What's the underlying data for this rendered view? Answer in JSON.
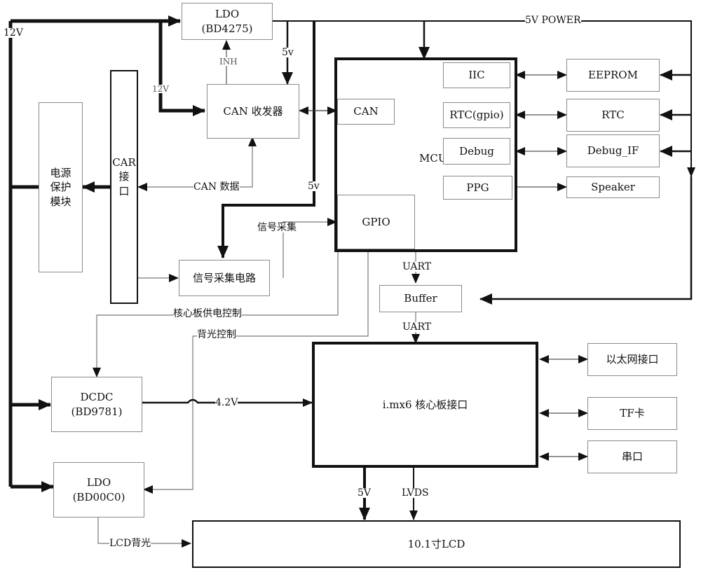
{
  "blocks": {
    "ldo_top": {
      "line1": "LDO",
      "line2": "(BD4275)"
    },
    "can_transceiver": "CAN 收发器",
    "power_protect": "电源\n保护\n模块",
    "car_interface": "CAR\n接\n口",
    "signal_circuit": "信号采集电路",
    "mcu": "MCU",
    "mcu_can": "CAN",
    "mcu_gpio": "GPIO",
    "mcu_iic": "IIC",
    "mcu_rtc": "RTC(gpio)",
    "mcu_debug": "Debug",
    "mcu_ppg": "PPG",
    "eeprom": "EEPROM",
    "rtc": "RTC",
    "debug_if": "Debug_IF",
    "speaker": "Speaker",
    "buffer": "Buffer",
    "imx6": "i.mx6 核心板接口",
    "ethernet": "以太网接口",
    "tf_card": "TF卡",
    "serial": "串口",
    "dcdc": {
      "line1": "DCDC",
      "line2": "(BD9781)"
    },
    "ldo_bottom": {
      "line1": "LDO",
      "line2": "(BD00C0)"
    },
    "lcd": "10.1寸LCD"
  },
  "labels": {
    "v12_main": "12V",
    "v12_branch": "12V",
    "inh": "INH",
    "v5_top": "5v",
    "v5_mid": "5v",
    "v5_power": "5V POWER",
    "can_data": "CAN 数据",
    "signal_acq": "信号采集",
    "uart_1": "UART",
    "uart_2": "UART",
    "core_power_ctrl": "核心板供电控制",
    "backlight_ctrl": "背光控制",
    "v4_2": "4.2V",
    "v5_lcd": "5V",
    "lvds": "LVDS",
    "lcd_backlight": "LCD背光"
  }
}
